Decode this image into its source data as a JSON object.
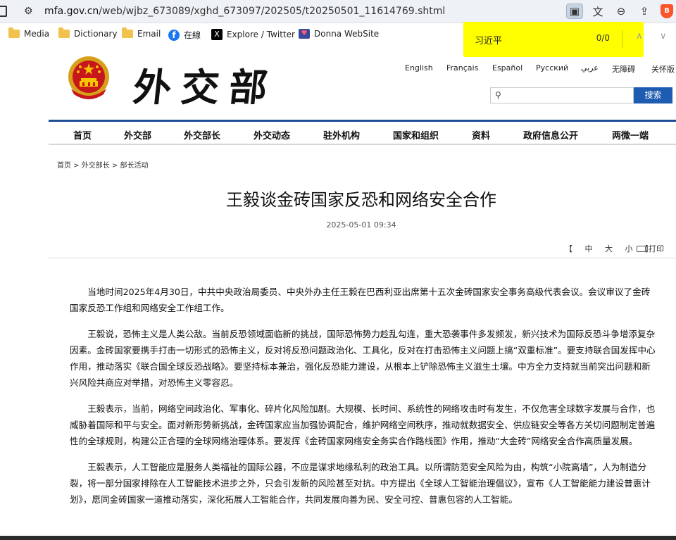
{
  "browser": {
    "url_host": "mfa.gov.cn",
    "url_path": "/web/wjbz_673089/xghd_673097/202505/t20250501_11614769.shtml",
    "bookmarks": [
      {
        "label": "Media",
        "icon": "folder-icon"
      },
      {
        "label": "Dictionary",
        "icon": "folder-icon"
      },
      {
        "label": "Email",
        "icon": "folder-icon"
      },
      {
        "label": "在線",
        "icon": "facebook-icon"
      },
      {
        "label": "Explore / Twitter",
        "icon": "x-icon"
      },
      {
        "label": "Donna WebSite",
        "icon": "donna-icon"
      }
    ],
    "find": {
      "query": "习近平",
      "count": "0/0"
    }
  },
  "header": {
    "calligraphy": "外交部",
    "languages": [
      "English",
      "Français",
      "Español",
      "Русский",
      "عربي",
      "无障碍",
      "关怀版"
    ],
    "search_button": "搜索",
    "search_value": ""
  },
  "nav": [
    "首页",
    "外交部",
    "外交部长",
    "外交动态",
    "驻外机构",
    "国家和组织",
    "资料",
    "政府信息公开",
    "两微一端"
  ],
  "breadcrumb": "首页 > 外交部长 > 部长活动",
  "article": {
    "title": "王毅谈金砖国家反恐和网络安全合作",
    "date": "2025-05-01 09:34",
    "font_sizes": [
      "【",
      "中",
      "大",
      "小",
      "】"
    ],
    "print_label": "打印",
    "paragraphs": [
      "当地时间2025年4月30日，中共中央政治局委员、中央外办主任王毅在巴西利亚出席第十五次金砖国家安全事务高级代表会议。会议审议了金砖国家反恐工作组和网络安全工作组工作。",
      "王毅说，恐怖主义是人类公敌。当前反恐领域面临新的挑战，国际恐怖势力趁乱勾连，重大恐袭事件多发频发，新兴技术为国际反恐斗争增添复杂因素。金砖国家要携手打击一切形式的恐怖主义，反对将反恐问题政治化、工具化，反对在打击恐怖主义问题上搞“双重标准”。要支持联合国发挥中心作用，推动落实《联合国全球反恐战略》。要坚持标本兼治，强化反恐能力建设，从根本上铲除恐怖主义滋生土壤。中方全力支持就当前突出问题和新兴风险共商应对举措，对恐怖主义零容忍。",
      "王毅表示，当前，网络空间政治化、军事化、碎片化风险加剧。大规模、长时间、系统性的网络攻击时有发生，不仅危害全球数字发展与合作，也威胁着国际和平与安全。面对新形势新挑战，金砖国家应当加强协调配合，维护网络空间秩序，推动就数据安全、供应链安全等各方关切问题制定普遍性的全球规则，构建公正合理的全球网络治理体系。要发挥《金砖国家网络安全务实合作路线图》作用，推动“大金砖”网络安全合作高质量发展。",
      "王毅表示，人工智能应是服务人类福祉的国际公器，不应是谋求地缘私利的政治工具。以所谓防范安全风险为由，构筑“小院高墙”，人为制造分裂，将一部分国家排除在人工智能技术进步之外，只会引发新的风险甚至对抗。中方提出《全球人工智能治理倡议》，宣布《人工智能能力建设普惠计划》，愿同金砖国家一道推动落实，深化拓展人工智能合作，共同发展向善为民、安全可控、普惠包容的人工智能。"
    ]
  }
}
